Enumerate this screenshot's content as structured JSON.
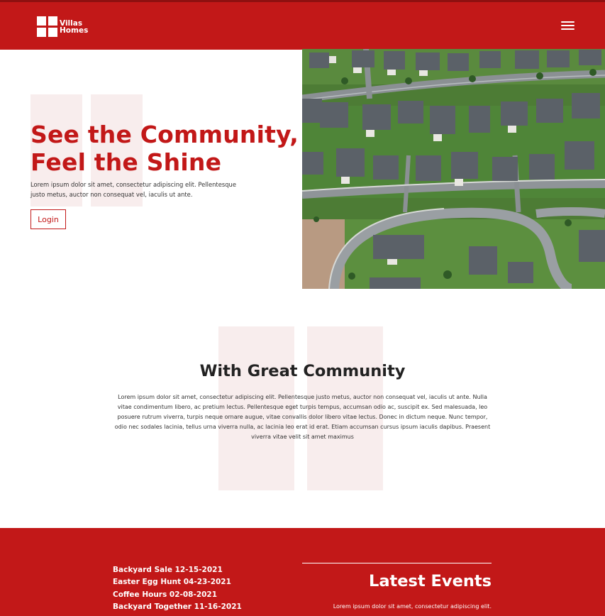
{
  "brand": {
    "line1": "Villas",
    "line2": "Homes"
  },
  "hero": {
    "title_line1": "See the Community,",
    "title_line2": "Feel the Shine",
    "description": "Lorem ipsum dolor sit amet, consectetur adipiscing elit. Pellentesque justo metus, auctor non consequat vel, iaculis ut ante.",
    "login_label": "Login"
  },
  "community": {
    "title": "With Great Community",
    "text": "Lorem ipsum dolor sit amet, consectetur adipiscing elit. Pellentesque justo metus, auctor non consequat vel, iaculis ut ante. Nulla vitae condimentum libero, ac pretium lectus. Pellentesque eget turpis tempus, accumsan odio ac, suscipit ex. Sed malesuada, leo posuere rutrum viverra, turpis neque ornare augue, vitae convallis dolor libero vitae lectus. Donec in dictum neque. Nunc tempor, odio nec sodales lacinia, tellus urna viverra nulla, ac lacinia leo erat id erat. Etiam accumsan cursus ipsum iaculis dapibus. Praesent viverra vitae velit sit amet maximus"
  },
  "events": {
    "items": [
      "Backyard Sale 12-15-2021",
      "Easter Egg Hunt 04-23-2021",
      "Coffee Hours 02-08-2021",
      "Backyard Together 11-16-2021"
    ],
    "title": "Latest Events",
    "text": "Lorem ipsum dolor sit amet, consectetur adipiscing elit."
  },
  "colors": {
    "brand_red": "#c21818",
    "deco_pink": "#f8eded"
  },
  "icons": {
    "menu": "hamburger-menu-icon",
    "logo": "logo-grid-icon"
  }
}
